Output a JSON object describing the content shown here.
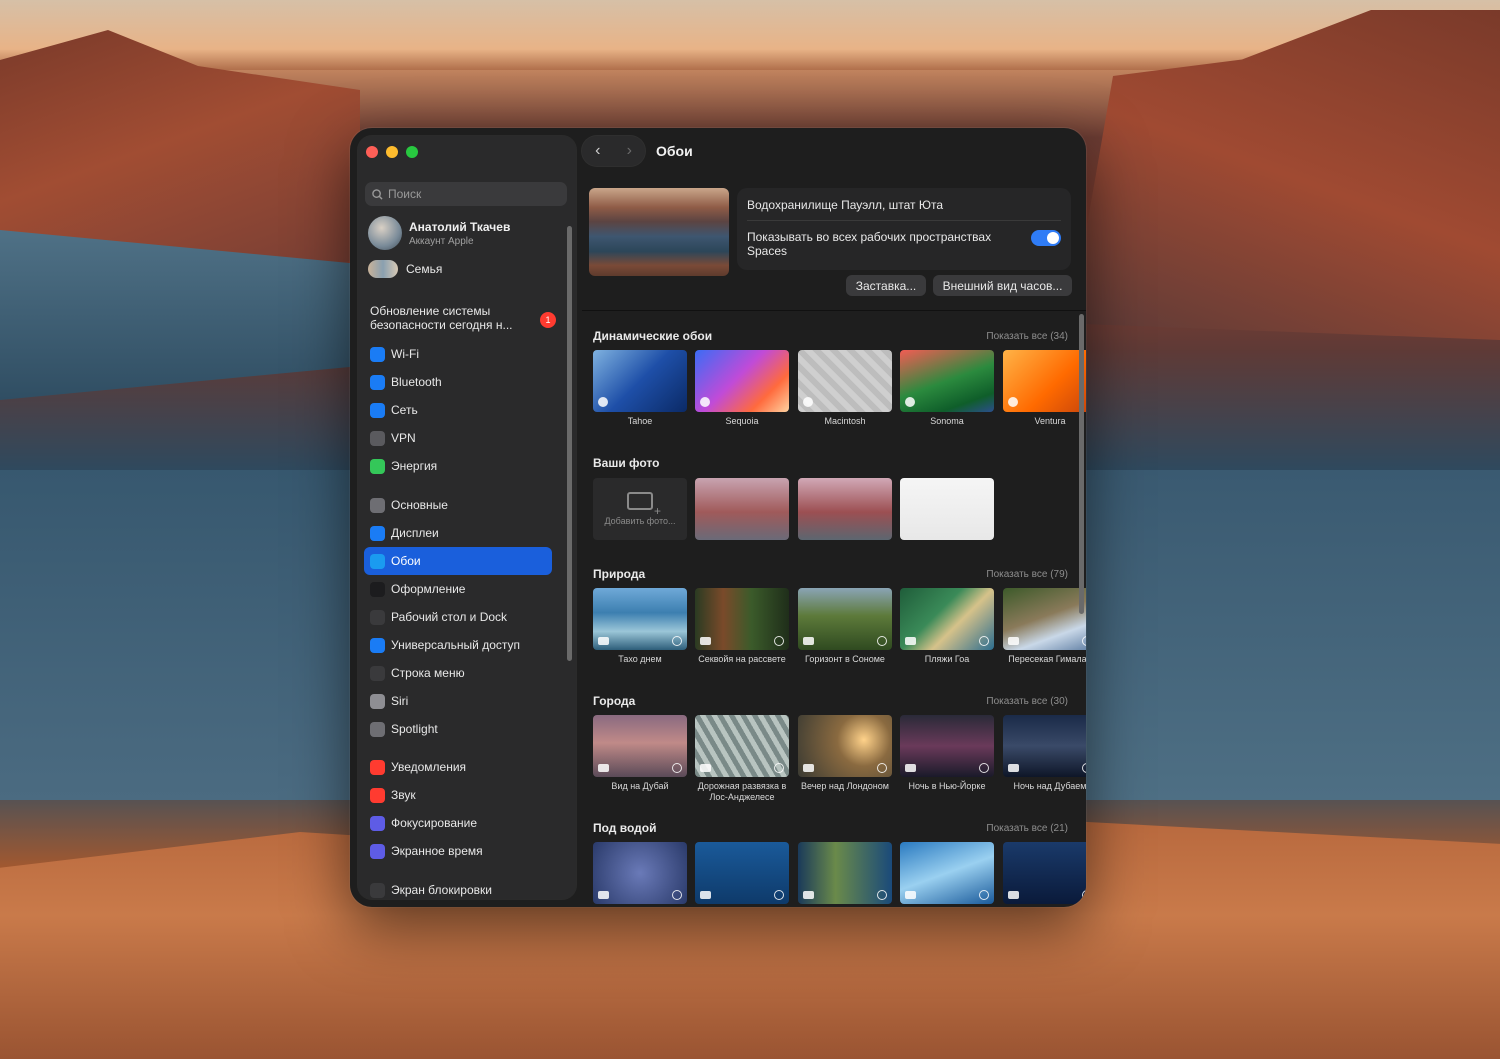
{
  "sidebar": {
    "search_placeholder": "Поиск",
    "profile": {
      "name": "Анатолий Ткачев",
      "subtitle": "Аккаунт Apple"
    },
    "family": "Семья",
    "update": {
      "text": "Обновление системы безопасности сегодня н...",
      "badge": "1"
    },
    "group1": [
      {
        "label": "Wi-Fi",
        "icon": "wifi-icon",
        "color": "#1a7cf5"
      },
      {
        "label": "Bluetooth",
        "icon": "bluetooth-icon",
        "color": "#1a7cf5"
      },
      {
        "label": "Сеть",
        "icon": "globe-icon",
        "color": "#1a7cf5"
      },
      {
        "label": "VPN",
        "icon": "vpn-icon",
        "color": "#5a5a5e"
      },
      {
        "label": "Энергия",
        "icon": "battery-icon",
        "color": "#34c759"
      }
    ],
    "group2": [
      {
        "label": "Основные",
        "icon": "gear-icon",
        "color": "#6e6e73"
      },
      {
        "label": "Дисплеи",
        "icon": "display-icon",
        "color": "#1a7cf5"
      },
      {
        "label": "Обои",
        "icon": "wallpaper-icon",
        "color": "#1a9bf0",
        "active": true
      },
      {
        "label": "Оформление",
        "icon": "appearance-icon",
        "color": "#1c1c1e"
      },
      {
        "label": "Рабочий стол и Dock",
        "icon": "dock-icon",
        "color": "#3a3a3c"
      },
      {
        "label": "Универсальный доступ",
        "icon": "accessibility-icon",
        "color": "#1a7cf5"
      },
      {
        "label": "Строка меню",
        "icon": "menubar-icon",
        "color": "#3a3a3c"
      },
      {
        "label": "Siri",
        "icon": "siri-icon",
        "color": "#8e8e93"
      },
      {
        "label": "Spotlight",
        "icon": "spotlight-icon",
        "color": "#6e6e73"
      }
    ],
    "group3": [
      {
        "label": "Уведомления",
        "icon": "bell-icon",
        "color": "#ff3b30"
      },
      {
        "label": "Звук",
        "icon": "speaker-icon",
        "color": "#ff3b30"
      },
      {
        "label": "Фокусирование",
        "icon": "moon-icon",
        "color": "#5e5ce6"
      },
      {
        "label": "Экранное время",
        "icon": "hourglass-icon",
        "color": "#5e5ce6"
      }
    ],
    "group4": [
      {
        "label": "Экран блокировки",
        "icon": "lock-icon",
        "color": "#3a3a3c"
      }
    ]
  },
  "main": {
    "title": "Обои",
    "current": {
      "name": "Водохранилище Пауэлл, штат Юта",
      "spaces_label": "Показывать во всех рабочих пространствах Spaces",
      "spaces_on": true
    },
    "buttons": {
      "screensaver": "Заставка...",
      "clock": "Внешний вид часов..."
    },
    "sections": {
      "dynamic": {
        "title": "Динамические обои",
        "more": "Показать все (34)",
        "items": [
          {
            "label": "Tahoe",
            "bg": "linear-gradient(135deg,#7fb2e0,#1e4fa8 50%,#0b2a66)"
          },
          {
            "label": "Sequoia",
            "bg": "linear-gradient(135deg,#3b6cf5,#c04bd8 45%,#ff6a3d 75%,#ffd2a0)"
          },
          {
            "label": "Macintosh",
            "bg": "repeating-linear-gradient(45deg,#cfcfcf 0 6px,#bdbdbd 6px 12px)"
          },
          {
            "label": "Sonoma",
            "bg": "linear-gradient(160deg,#f25c54,#2b8a3e 50%,#0f5e2a 80%,#2b4e8c)"
          },
          {
            "label": "Ventura",
            "bg": "linear-gradient(135deg,#ffb347,#ff6a00 55%,#c2410c)"
          }
        ]
      },
      "photos": {
        "title": "Ваши фото",
        "add_label": "Добавить фото...",
        "items": [
          {
            "bg": "linear-gradient(180deg,#c8a3b0,#a05a5a 55%,#6a6a78)"
          },
          {
            "bg": "linear-gradient(180deg,#d1a8b6,#9c4f52 55%,#5c6670)"
          },
          {
            "bg": "linear-gradient(180deg,#f5f5f5,#e8e8e8)"
          }
        ]
      },
      "nature": {
        "title": "Природа",
        "more": "Показать все (79)",
        "items": [
          {
            "label": "Тахо днем",
            "bg": "linear-gradient(180deg,#6fa9d8,#3c7fb0 40%,#9bc6d8 70%,#2d5e7a)"
          },
          {
            "label": "Секвойя на рассвете",
            "bg": "linear-gradient(90deg,#2a3b22,#7a4a2a 30%,#3b5b2a 60%,#1f2e1a)"
          },
          {
            "label": "Горизонт в Сономе",
            "bg": "linear-gradient(180deg,#8aa4b5,#5d7a3a 45%,#2f4a20)"
          },
          {
            "label": "Пляжи Гоа",
            "bg": "linear-gradient(135deg,#1f5d3a,#3a8a58 40%,#d6c28a 60%,#2c6d8f)"
          },
          {
            "label": "Пересекая Гималаи",
            "bg": "linear-gradient(160deg,#3d5a2a,#8a7a5a 45%,#c9d8e8 70%,#5a7aa0)"
          }
        ]
      },
      "cities": {
        "title": "Города",
        "more": "Показать все (30)",
        "items": [
          {
            "label": "Вид на Дубай",
            "bg": "linear-gradient(180deg,#8a6a80,#c08a88 45%,#5a4a58)"
          },
          {
            "label": "Дорожная развязка в Лос-Анджелесе",
            "bg": "repeating-linear-gradient(60deg,#7a8a88 0 5px,#b8c4c0 5px 10px)"
          },
          {
            "label": "Вечер над Лондоном",
            "bg": "radial-gradient(circle at 70% 40%,#ffd28a,#8a6a40 35%,#3a3a32)"
          },
          {
            "label": "Ночь в Нью-Йорке",
            "bg": "linear-gradient(180deg,#2a2a38,#6a3a5a 50%,#1a1a2a)"
          },
          {
            "label": "Ночь над Дубаем",
            "bg": "linear-gradient(180deg,#1a2a48,#3a4a68 50%,#0e1628)"
          }
        ]
      },
      "underwater": {
        "title": "Под водой",
        "more": "Показать все (21)",
        "items": [
          {
            "bg": "radial-gradient(circle,#6a7ab8,#2a3a6a)"
          },
          {
            "bg": "linear-gradient(180deg,#1a5a9a,#0e3a6a)"
          },
          {
            "bg": "linear-gradient(90deg,#1a3a5a,#6a8a4a 40%,#1a4a7a)"
          },
          {
            "bg": "linear-gradient(160deg,#2a7ac0,#9ad0f0 50%,#1a5a9a)"
          },
          {
            "bg": "linear-gradient(180deg,#1a3a6a,#0a1a3a)"
          }
        ]
      }
    }
  }
}
